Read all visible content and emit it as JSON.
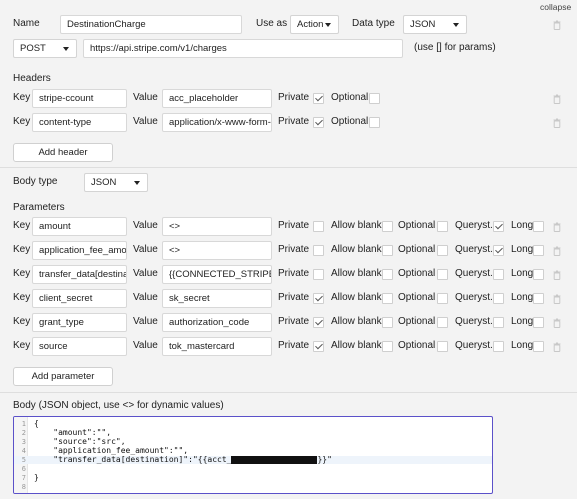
{
  "collapse_label": "collapse",
  "top": {
    "name_label": "Name",
    "name_value": "DestinationCharge",
    "use_as_label": "Use as",
    "use_as_value": "Action",
    "data_type_label": "Data type",
    "data_type_value": "JSON",
    "method_value": "POST",
    "url_value": "https://api.stripe.com/v1/charges",
    "url_hint": "(use [] for params)"
  },
  "headers": {
    "title": "Headers",
    "key_label": "Key",
    "value_label": "Value",
    "private_label": "Private",
    "optional_label": "Optional",
    "rows": [
      {
        "key": "stripe-ccount",
        "value": "acc_placeholder",
        "private": true,
        "optional": false
      },
      {
        "key": "content-type",
        "value": "application/x-www-form-",
        "private": true,
        "optional": false
      }
    ],
    "add_button": "Add header"
  },
  "body_type": {
    "label": "Body type",
    "value": "JSON"
  },
  "parameters": {
    "title": "Parameters",
    "key_label": "Key",
    "value_label": "Value",
    "private_label": "Private",
    "allow_blank_label": "Allow blank",
    "optional_label": "Optional",
    "queryst_label": "Queryst.",
    "long_label": "Long",
    "rows": [
      {
        "key": "amount",
        "value": "<>",
        "private": false,
        "allow_blank": false,
        "optional": false,
        "queryst": true,
        "long": false
      },
      {
        "key": "application_fee_amou",
        "value": "<>",
        "private": false,
        "allow_blank": false,
        "optional": false,
        "queryst": true,
        "long": false
      },
      {
        "key": "transfer_data[destinati",
        "value": "{{CONNECTED_STRIPE_AC",
        "private": false,
        "allow_blank": false,
        "optional": false,
        "queryst": false,
        "long": false
      },
      {
        "key": "client_secret",
        "value": "sk_secret",
        "private": true,
        "allow_blank": false,
        "optional": false,
        "queryst": false,
        "long": false
      },
      {
        "key": "grant_type",
        "value": "authorization_code",
        "private": true,
        "allow_blank": false,
        "optional": false,
        "queryst": false,
        "long": false
      },
      {
        "key": "source",
        "value": "tok_mastercard",
        "private": true,
        "allow_blank": false,
        "optional": false,
        "queryst": false,
        "long": false
      }
    ],
    "add_button": "Add parameter"
  },
  "body": {
    "label": "Body (JSON object, use <> for dynamic values)",
    "lines": [
      {
        "n": "1",
        "text": "{"
      },
      {
        "n": "2",
        "text": "    \"amount\":\"\","
      },
      {
        "n": "3",
        "text": "    \"source\":\"src\","
      },
      {
        "n": "4",
        "text": "    \"application_fee_amount\":\"\","
      },
      {
        "n": "5",
        "text": "    \"transfer_data[destination]\":\"{{acct_",
        "redacted": true,
        "tail": "}}\""
      },
      {
        "n": "6",
        "text": ""
      },
      {
        "n": "7",
        "text": "}"
      },
      {
        "n": "8",
        "text": ""
      }
    ],
    "active_line": 4
  }
}
